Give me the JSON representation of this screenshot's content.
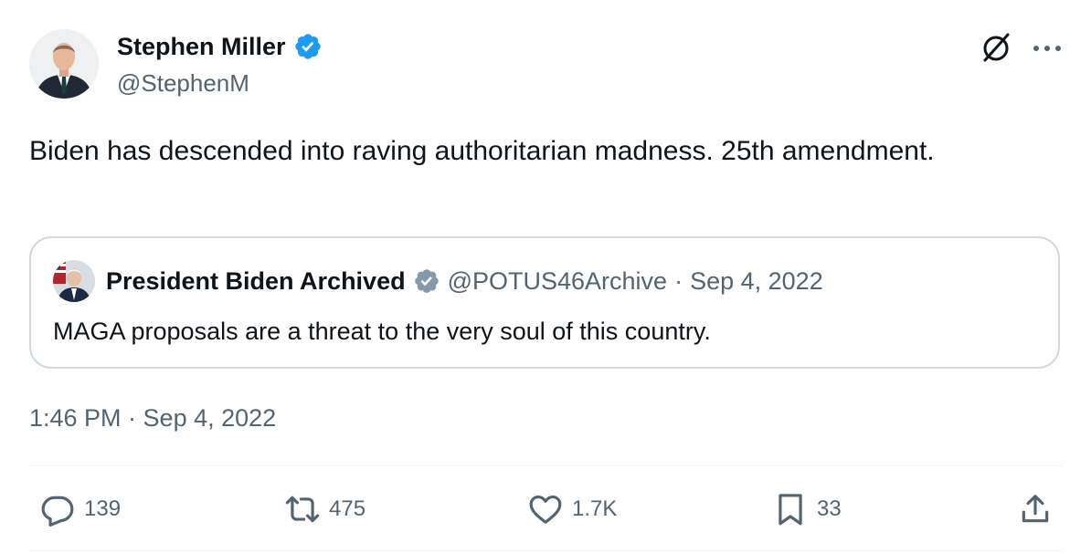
{
  "author": {
    "name": "Stephen Miller",
    "handle": "@StephenM"
  },
  "tweet": {
    "text": "Biden has descended into raving authoritarian madness. 25th amendment.",
    "timestamp": "1:46 PM · Sep 4, 2022"
  },
  "quoted": {
    "name": "President Biden Archived",
    "handle": "@POTUS46Archive",
    "date": "Sep 4, 2022",
    "separator": "·",
    "text": "MAGA proposals are a threat to the very soul of this country."
  },
  "actions": {
    "replies": "139",
    "reposts": "475",
    "likes": "1.7K",
    "bookmarks": "33"
  },
  "icons": {
    "verified_color": "#1d9bf0",
    "gov_verified_color": "#829aab",
    "grok": "grok-icon",
    "more": "more-icon",
    "reply": "reply-icon",
    "repost": "repost-icon",
    "like": "like-icon",
    "bookmark": "bookmark-icon",
    "share": "share-icon"
  },
  "colors": {
    "text": "#0f1419",
    "secondary": "#536471",
    "border": "#cfd9de"
  }
}
